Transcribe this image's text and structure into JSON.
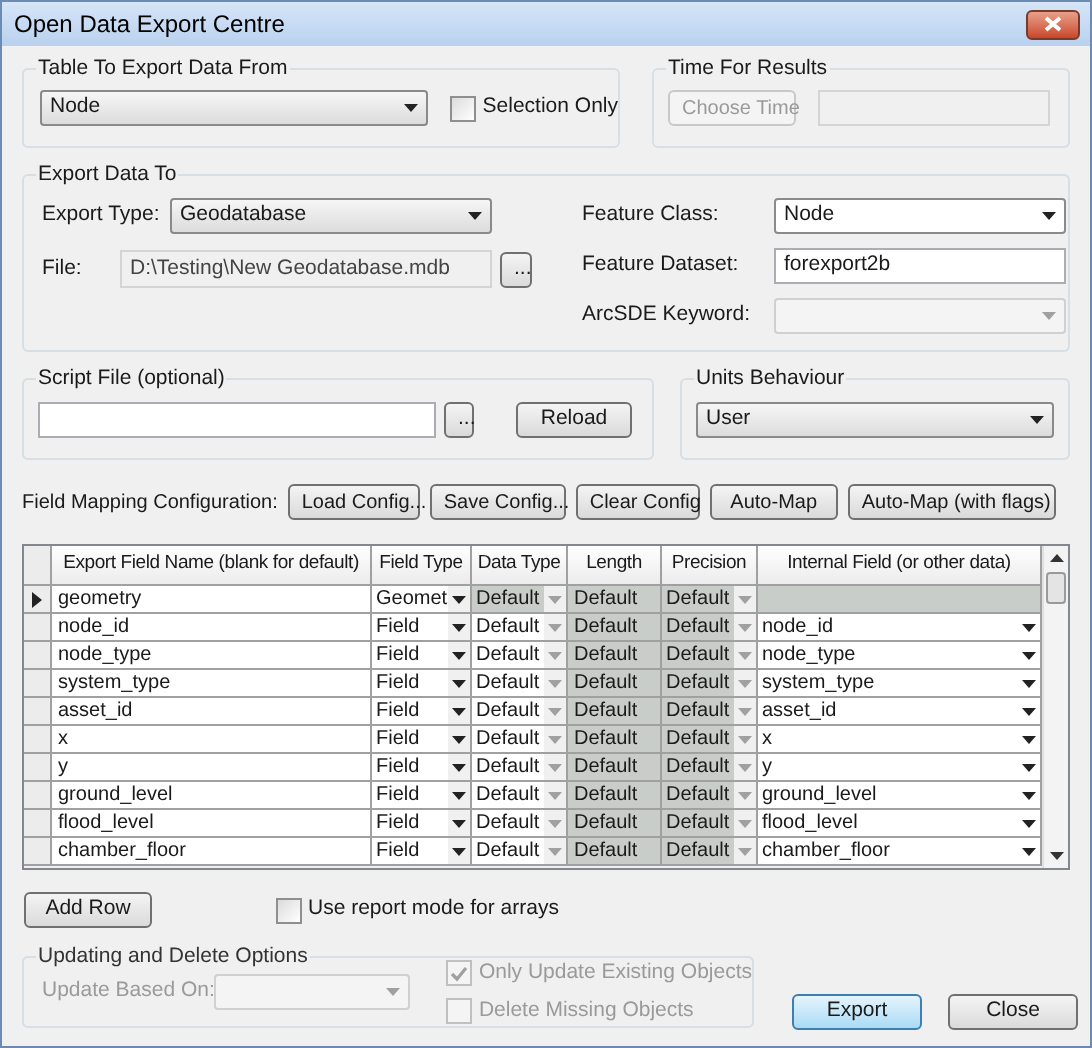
{
  "window": {
    "title": "Open Data Export Centre"
  },
  "source_group": {
    "title": "Table To Export Data From",
    "table": "Node",
    "selection_only": {
      "label": "Selection Only",
      "checked": false
    }
  },
  "time_group": {
    "title": "Time For Results",
    "button": {
      "label": "Choose Time",
      "disabled": true
    },
    "time_field": {
      "disabled": true
    }
  },
  "export_group": {
    "title": "Export Data To",
    "export_type": {
      "label": "Export Type:",
      "value": "Geodatabase"
    },
    "file": {
      "label": "File:",
      "value": "D:\\Testing\\New Geodatabase.mdb",
      "browse": "..."
    },
    "feature_class": {
      "label": "Feature Class:",
      "value": "Node"
    },
    "feature_dataset": {
      "label": "Feature Dataset:",
      "value": "forexport2b"
    },
    "arcsde_keyword": {
      "label": "ArcSDE Keyword:",
      "disabled": true
    }
  },
  "script_group": {
    "title": "Script File (optional)",
    "browse": "...",
    "reload": "Reload"
  },
  "units_group": {
    "title": "Units Behaviour",
    "value": "User"
  },
  "field_mapping": {
    "label": "Field Mapping Configuration:",
    "buttons": [
      "Load Config...",
      "Save Config...",
      "Clear Config",
      "Auto-Map",
      "Auto-Map (with flags)"
    ]
  },
  "table": {
    "columns": [
      "Export Field Name (blank for default)",
      "Field Type",
      "Data Type",
      "Length",
      "Precision",
      "Internal Field (or other data)"
    ],
    "rows": [
      {
        "name": "geometry",
        "field_type": "Geomet",
        "data_type": "Default",
        "length": "Default",
        "precision": "Default",
        "current": true,
        "locked": true
      },
      {
        "name": "node_id",
        "field_type": "Field",
        "data_type": "Default",
        "length": "Default",
        "precision": "Default",
        "internal": "node_id",
        "current": false,
        "locked": false
      },
      {
        "name": "node_type",
        "field_type": "Field",
        "data_type": "Default",
        "length": "Default",
        "precision": "Default",
        "internal": "node_type",
        "current": false,
        "locked": false
      },
      {
        "name": "system_type",
        "field_type": "Field",
        "data_type": "Default",
        "length": "Default",
        "precision": "Default",
        "internal": "system_type",
        "current": false,
        "locked": false
      },
      {
        "name": "asset_id",
        "field_type": "Field",
        "data_type": "Default",
        "length": "Default",
        "precision": "Default",
        "internal": "asset_id",
        "current": false,
        "locked": false
      },
      {
        "name": "x",
        "field_type": "Field",
        "data_type": "Default",
        "length": "Default",
        "precision": "Default",
        "internal": "x",
        "current": false,
        "locked": false
      },
      {
        "name": "y",
        "field_type": "Field",
        "data_type": "Default",
        "length": "Default",
        "precision": "Default",
        "internal": "y",
        "current": false,
        "locked": false
      },
      {
        "name": "ground_level",
        "field_type": "Field",
        "data_type": "Default",
        "length": "Default",
        "precision": "Default",
        "internal": "ground_level",
        "current": false,
        "locked": false
      },
      {
        "name": "flood_level",
        "field_type": "Field",
        "data_type": "Default",
        "length": "Default",
        "precision": "Default",
        "internal": "flood_level",
        "current": false,
        "locked": false
      },
      {
        "name": "chamber_floor",
        "field_type": "Field",
        "data_type": "Default",
        "length": "Default",
        "precision": "Default",
        "internal": "chamber_floor",
        "current": false,
        "locked": false
      }
    ]
  },
  "add_row": "Add Row",
  "report_mode": {
    "label": "Use report mode for arrays",
    "checked": false
  },
  "update_group": {
    "title": "Updating and Delete Options",
    "disabled": true,
    "update_based_on": {
      "label": "Update Based On:"
    },
    "options": [
      {
        "label": "Only Update Existing Objects",
        "checked": true
      },
      {
        "label": "Delete Missing Objects",
        "checked": false
      }
    ]
  },
  "buttons": [
    {
      "label": "Export",
      "focused": true
    },
    {
      "label": "Close",
      "focused": false
    }
  ]
}
